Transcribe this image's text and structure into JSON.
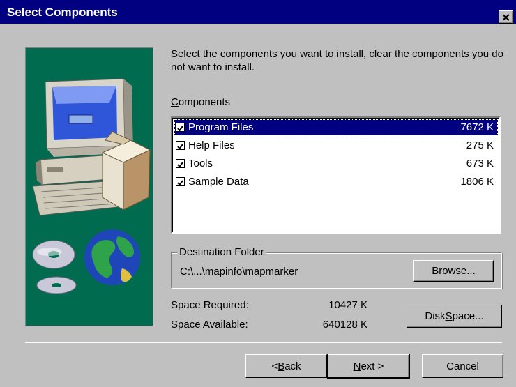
{
  "dialog": {
    "title": "Select Components",
    "intro": "Select the components you want to install, clear the components you do not want to install.",
    "components_label_accel": "C",
    "components_label_rest": "omponents",
    "components": [
      {
        "name": "Program Files",
        "size": "7672 K",
        "checked": true,
        "selected": true
      },
      {
        "name": "Help Files",
        "size": "275 K",
        "checked": true,
        "selected": false
      },
      {
        "name": "Tools",
        "size": "673 K",
        "checked": true,
        "selected": false
      },
      {
        "name": "Sample Data",
        "size": "1806 K",
        "checked": true,
        "selected": false
      }
    ],
    "destination": {
      "legend": "Destination Folder",
      "path": "C:\\...\\mapinfo\\mapmarker",
      "browse_pre": "B",
      "browse_accel": "r",
      "browse_post": "owse..."
    },
    "space": {
      "required_label": "Space Required:",
      "required_value": "10427 K",
      "available_label": "Space Available:",
      "available_value": "640128 K",
      "disk_space_pre": "Disk ",
      "disk_space_accel": "S",
      "disk_space_post": "pace..."
    },
    "buttons": {
      "back_pre": "< ",
      "back_accel": "B",
      "back_post": "ack",
      "next_accel": "N",
      "next_post": "ext >",
      "cancel": "Cancel"
    }
  }
}
